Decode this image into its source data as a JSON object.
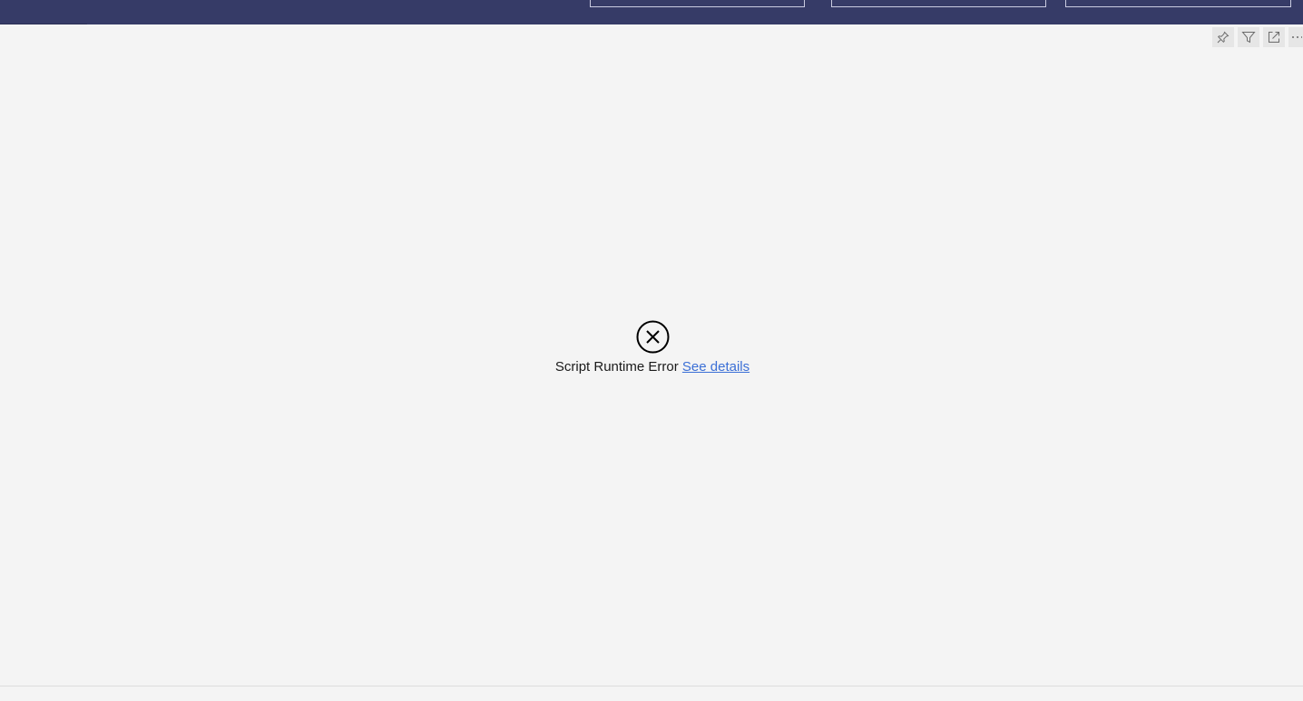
{
  "colors": {
    "banner": "#363b67",
    "canvas": "#f4f4f4",
    "link": "#3b6fd6",
    "header_button": "#e6e6e6"
  },
  "visual_header": {
    "buttons": [
      {
        "icon": "pin-icon"
      },
      {
        "icon": "filter-icon"
      },
      {
        "icon": "focus-mode-icon"
      },
      {
        "icon": "more-options-icon"
      }
    ]
  },
  "error": {
    "icon": "error-circle-x-icon",
    "message": "Script Runtime Error",
    "link_label": "See details"
  }
}
